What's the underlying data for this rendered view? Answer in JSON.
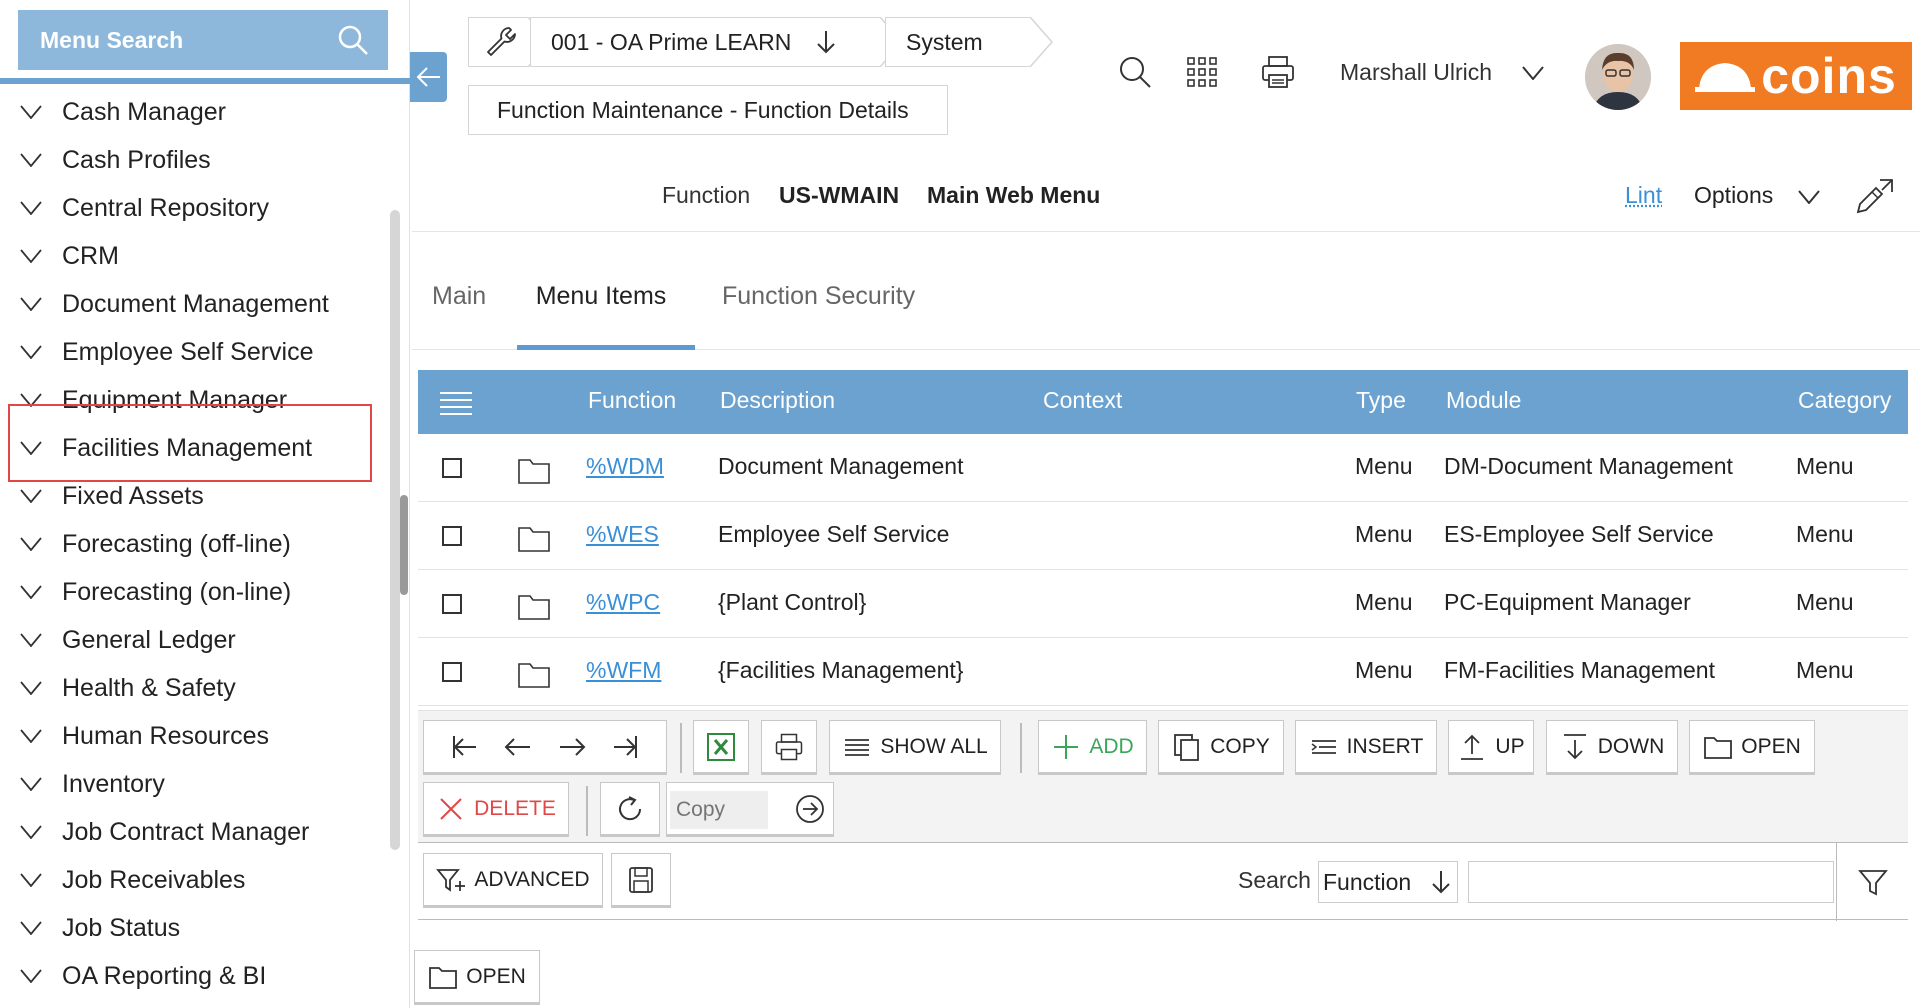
{
  "sidebar": {
    "search_label": "Menu Search",
    "items": [
      {
        "label": "Cash Manager"
      },
      {
        "label": "Cash Profiles"
      },
      {
        "label": "Central Repository"
      },
      {
        "label": "CRM"
      },
      {
        "label": "Document Management"
      },
      {
        "label": "Employee Self Service"
      },
      {
        "label": "Equipment Manager"
      },
      {
        "label": "Facilities Management"
      },
      {
        "label": "Fixed Assets"
      },
      {
        "label": "Forecasting (off-line)"
      },
      {
        "label": "Forecasting (on-line)"
      },
      {
        "label": "General Ledger"
      },
      {
        "label": "Health & Safety"
      },
      {
        "label": "Human Resources"
      },
      {
        "label": "Inventory"
      },
      {
        "label": "Job Contract Manager"
      },
      {
        "label": "Job Receivables"
      },
      {
        "label": "Job Status"
      },
      {
        "label": "OA Reporting & BI"
      }
    ],
    "highlighted_item": "Facilities Management"
  },
  "topbar": {
    "company": "001 - OA Prime LEARN",
    "system": "System",
    "page": "Function Maintenance - Function Details",
    "user_name": "Marshall Ulrich",
    "brand": "coins",
    "brand_color": "#f07b22"
  },
  "function_header": {
    "label": "Function",
    "code": "US-WMAIN",
    "name": "Main Web Menu",
    "lint": "Lint",
    "options": "Options"
  },
  "tabs": [
    {
      "label": "Main",
      "active": false
    },
    {
      "label": "Menu Items",
      "active": true
    },
    {
      "label": "Function Security",
      "active": false
    }
  ],
  "grid": {
    "columns": [
      "Function",
      "Description",
      "Context",
      "Type",
      "Module",
      "Category"
    ],
    "rows": [
      {
        "function": "%WDM",
        "description": "Document Management",
        "context": "",
        "type": "Menu",
        "module": "DM-Document Management",
        "category": "Menu"
      },
      {
        "function": "%WES",
        "description": "Employee Self Service",
        "context": "",
        "type": "Menu",
        "module": "ES-Employee Self Service",
        "category": "Menu"
      },
      {
        "function": "%WPC",
        "description": "{Plant Control}",
        "context": "",
        "type": "Menu",
        "module": "PC-Equipment Manager",
        "category": "Menu"
      },
      {
        "function": "%WFM",
        "description": "{Facilities Management}",
        "context": "",
        "type": "Menu",
        "module": "FM-Facilities Management",
        "category": "Menu"
      }
    ]
  },
  "toolbar": {
    "show_all": "SHOW ALL",
    "add": "ADD",
    "copy": "COPY",
    "insert": "INSERT",
    "up": "UP",
    "down": "DOWN",
    "open": "OPEN",
    "delete": "DELETE",
    "copy_placeholder": "Copy"
  },
  "searchbar": {
    "advanced": "ADVANCED",
    "search_label": "Search",
    "search_field": "Function"
  },
  "bottom": {
    "open": "OPEN"
  },
  "colors": {
    "accent": "#6ba2cf",
    "link": "#3b8fd6",
    "delete": "#e04848",
    "add": "#3aa65a"
  }
}
